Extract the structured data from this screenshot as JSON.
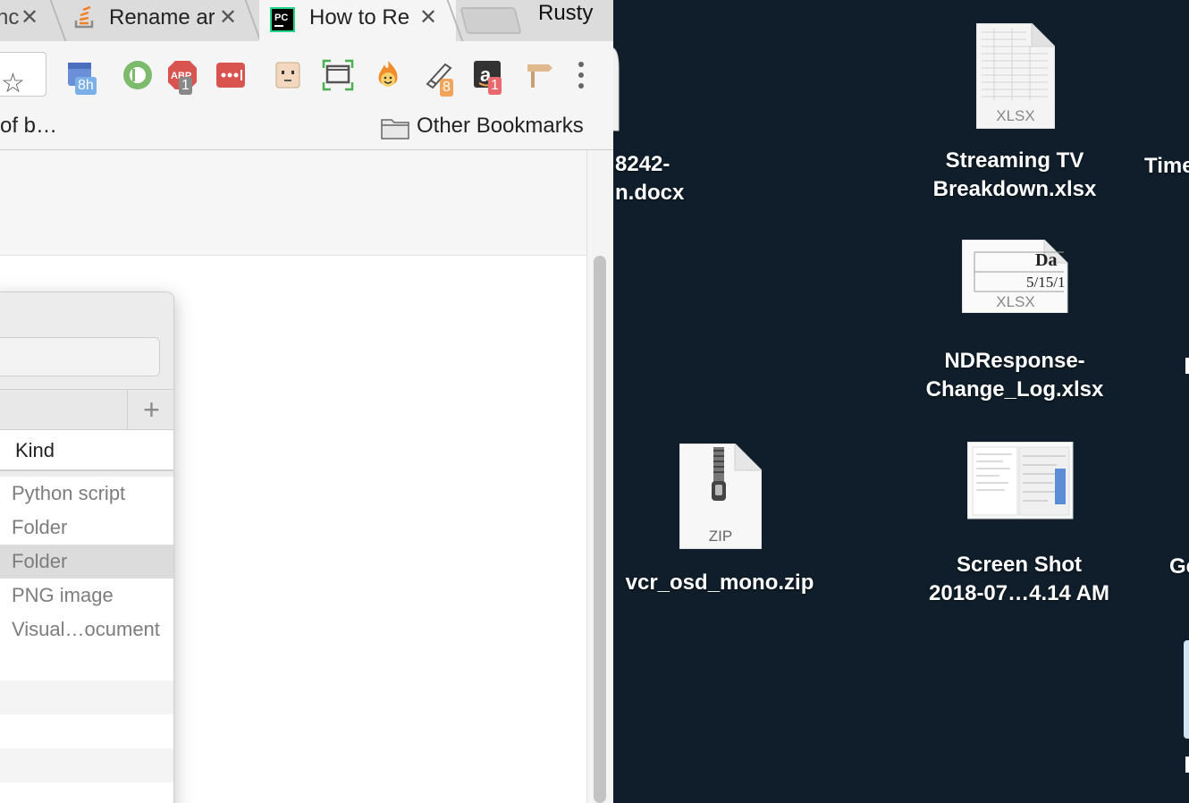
{
  "browser": {
    "tabs": [
      {
        "title": "nc",
        "close": "✕"
      },
      {
        "title": "Rename ar",
        "close": "✕",
        "favicon": "stackoverflow-icon"
      },
      {
        "title": "How to Re",
        "close": "✕",
        "favicon": "pycharm-icon",
        "active": true
      }
    ],
    "profile_name": "Rusty",
    "extensions": [
      {
        "name": "calendar-extension",
        "badge": "8h"
      },
      {
        "name": "id-extension"
      },
      {
        "name": "adblock-extension",
        "badge": "1"
      },
      {
        "name": "lastpass-extension"
      },
      {
        "name": "face-extension"
      },
      {
        "name": "screenshot-extension"
      },
      {
        "name": "hola-extension"
      },
      {
        "name": "pen-extension",
        "badge": "8"
      },
      {
        "name": "amazon-extension",
        "badge": "1"
      },
      {
        "name": "signpost-extension"
      }
    ],
    "bookmarks": {
      "truncated_item": "of b…",
      "other_bookmarks": "Other Bookmarks"
    }
  },
  "dialog": {
    "add_button": "+",
    "column_kind": "Kind",
    "rows": [
      "Python script",
      "Folder",
      "Folder",
      "PNG image",
      "Visual…ocument"
    ]
  },
  "desktop": {
    "items": [
      {
        "name": "docx-file",
        "label_lines": [
          "8242-",
          "n.docx"
        ]
      },
      {
        "name": "streaming-tv-file",
        "label_lines": [
          "Streaming TV",
          "Breakdown.xlsx"
        ],
        "type": "XLSX"
      },
      {
        "name": "time-file",
        "label_lines": [
          "Time"
        ]
      },
      {
        "name": "ndresponse-file",
        "label_lines": [
          "NDResponse-",
          "Change_Log.xlsx"
        ],
        "type": "XLSX",
        "preview_text_1": "Da",
        "preview_text_2": "5/15/1"
      },
      {
        "name": "vcr-zip-file",
        "label_lines": [
          "vcr_osd_mono.zip"
        ],
        "type": "ZIP"
      },
      {
        "name": "screenshot-file",
        "label_lines": [
          "Screen Shot",
          "2018-07…4.14 AM"
        ]
      },
      {
        "name": "g-file",
        "label_lines": [
          "Ge"
        ]
      }
    ]
  },
  "colors": {
    "desktop_bg": "#0f1e2a",
    "chrome_bg": "#f5f5f5"
  }
}
